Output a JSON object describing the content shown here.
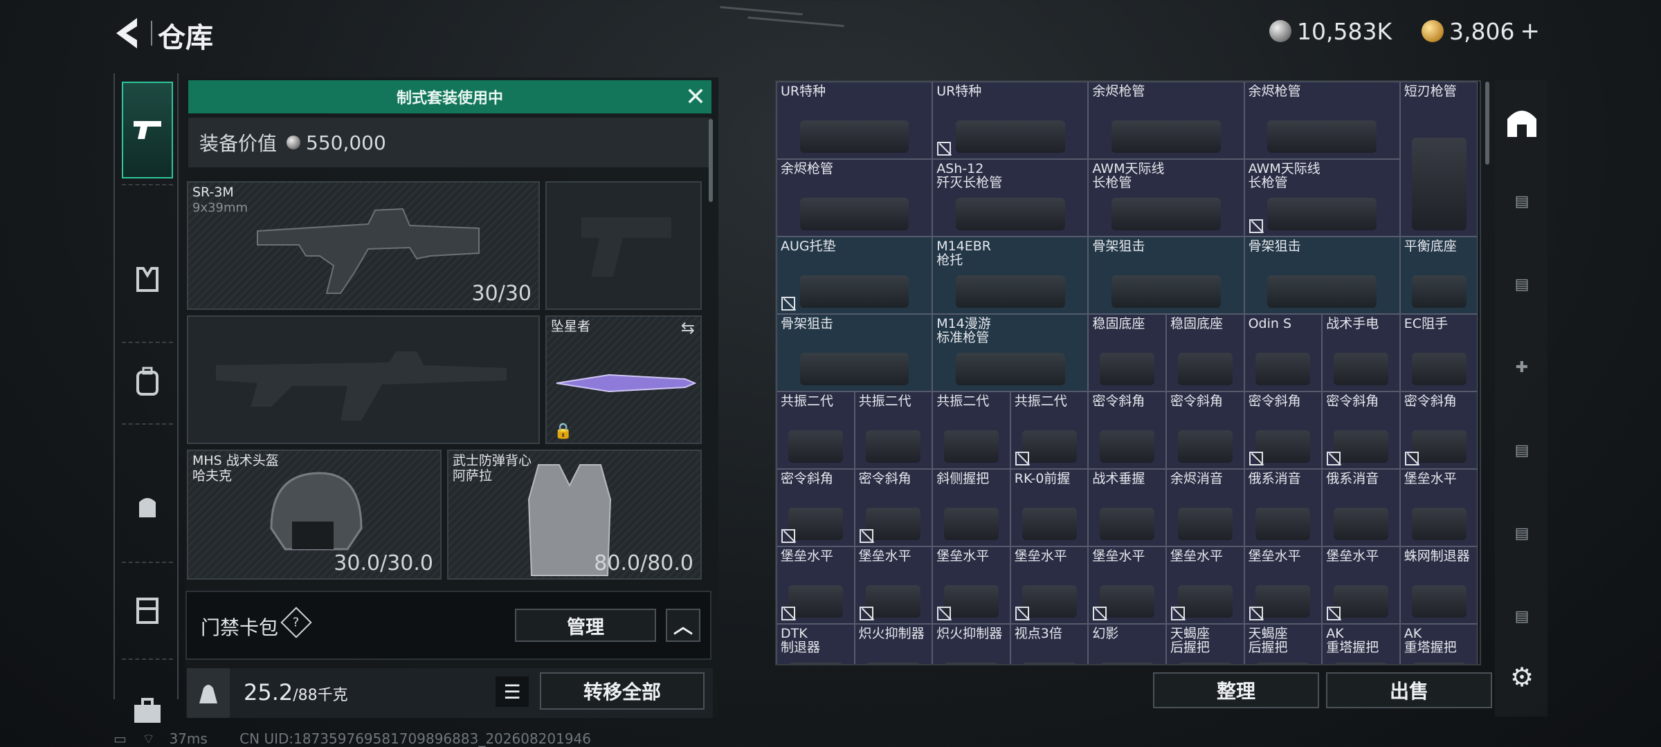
{
  "header": {
    "title": "仓库",
    "silver": "10,583K",
    "gold": "3,806"
  },
  "loadout": {
    "banner": "制式套装使用中",
    "value_label": "装备价值",
    "value": "550,000",
    "primary": {
      "name": "SR-3M",
      "caliber": "9x39mm",
      "ammo": "30/30"
    },
    "melee": {
      "name": "坠星者"
    },
    "helmet": {
      "name": "MHS 战术头盔",
      "sub": "哈夫克",
      "durability": "30.0/30.0"
    },
    "armor": {
      "name": "武士防弹背心",
      "sub": "阿萨拉",
      "durability": "80.0/80.0"
    },
    "keycard": {
      "label": "门禁卡包",
      "help": "?",
      "manage": "管理"
    },
    "weight": {
      "current": "25.2",
      "max": "/88千克"
    },
    "transfer_all": "转移全部"
  },
  "grid": {
    "rows": [
      [
        {
          "l": "UR特种",
          "c": "purple",
          "w": 2
        },
        {
          "l": "UR特种",
          "c": "purple",
          "w": 2,
          "x": 1
        },
        {
          "l": "余烬枪管",
          "c": "purple",
          "w": 2
        },
        {
          "l": "余烬枪管",
          "c": "purple",
          "w": 2
        },
        {
          "l": "短刃枪管",
          "c": "purple",
          "w": 1,
          "h": 2
        }
      ],
      [
        {
          "l": "余烬枪管",
          "c": "purple",
          "w": 2
        },
        {
          "l": "ASh-12",
          "s": "歼灭长枪管",
          "c": "purple",
          "w": 2
        },
        {
          "l": "AWM天际线",
          "s": "长枪管",
          "c": "purple",
          "w": 2
        },
        {
          "l": "AWM天际线",
          "s": "长枪管",
          "c": "purple",
          "w": 2,
          "x": 1
        }
      ],
      [
        {
          "l": "AUG托垫",
          "c": "blue",
          "w": 2,
          "x": 1
        },
        {
          "l": "M14EBR",
          "s": "枪托",
          "c": "blue",
          "w": 2
        },
        {
          "l": "骨架狙击",
          "c": "blue",
          "w": 2
        },
        {
          "l": "骨架狙击",
          "c": "blue",
          "w": 2
        },
        {
          "l": "平衡底座",
          "c": "blue",
          "w": 1
        }
      ],
      [
        {
          "l": "骨架狙击",
          "c": "blue",
          "w": 2
        },
        {
          "l": "M14漫游",
          "s": "标准枪管",
          "c": "blue",
          "w": 2
        },
        {
          "l": "稳固底座",
          "c": "purple",
          "w": 1
        },
        {
          "l": "稳固底座",
          "c": "purple",
          "w": 1
        },
        {
          "l": "Odin S",
          "c": "purple",
          "w": 1
        },
        {
          "l": "战术手电",
          "c": "purple",
          "w": 1
        },
        {
          "l": "EC阻手",
          "c": "purple",
          "w": 1
        }
      ],
      [
        {
          "l": "共振二代",
          "c": "purple",
          "w": 1
        },
        {
          "l": "共振二代",
          "c": "purple",
          "w": 1
        },
        {
          "l": "共振二代",
          "c": "purple",
          "w": 1
        },
        {
          "l": "共振二代",
          "c": "purple",
          "w": 1,
          "x": 1
        },
        {
          "l": "密令斜角",
          "c": "purple",
          "w": 1
        },
        {
          "l": "密令斜角",
          "c": "purple",
          "w": 1
        },
        {
          "l": "密令斜角",
          "c": "purple",
          "w": 1,
          "x": 1
        },
        {
          "l": "密令斜角",
          "c": "purple",
          "w": 1,
          "x": 1
        },
        {
          "l": "密令斜角",
          "c": "purple",
          "w": 1,
          "x": 1
        }
      ],
      [
        {
          "l": "密令斜角",
          "c": "purple",
          "w": 1,
          "x": 1
        },
        {
          "l": "密令斜角",
          "c": "purple",
          "w": 1,
          "x": 1
        },
        {
          "l": "斜侧握把",
          "c": "purple",
          "w": 1
        },
        {
          "l": "RK-0前握",
          "c": "purple",
          "w": 1
        },
        {
          "l": "战术垂握",
          "c": "purple",
          "w": 1
        },
        {
          "l": "余烬消音",
          "c": "purple",
          "w": 1
        },
        {
          "l": "俄系消音",
          "c": "purple",
          "w": 1
        },
        {
          "l": "俄系消音",
          "c": "purple",
          "w": 1
        },
        {
          "l": "堡垒水平",
          "c": "purple",
          "w": 1
        }
      ],
      [
        {
          "l": "堡垒水平",
          "c": "purple",
          "w": 1,
          "x": 1
        },
        {
          "l": "堡垒水平",
          "c": "purple",
          "w": 1,
          "x": 1
        },
        {
          "l": "堡垒水平",
          "c": "purple",
          "w": 1,
          "x": 1
        },
        {
          "l": "堡垒水平",
          "c": "purple",
          "w": 1,
          "x": 1
        },
        {
          "l": "堡垒水平",
          "c": "purple",
          "w": 1,
          "x": 1
        },
        {
          "l": "堡垒水平",
          "c": "purple",
          "w": 1,
          "x": 1
        },
        {
          "l": "堡垒水平",
          "c": "purple",
          "w": 1,
          "x": 1
        },
        {
          "l": "堡垒水平",
          "c": "purple",
          "w": 1,
          "x": 1
        },
        {
          "l": "蛛网制退器",
          "c": "purple",
          "w": 1
        }
      ],
      [
        {
          "l": "DTK",
          "s": "制退器",
          "c": "purple",
          "w": 1
        },
        {
          "l": "炽火抑制器",
          "c": "purple",
          "w": 1
        },
        {
          "l": "炽火抑制器",
          "c": "purple",
          "w": 1
        },
        {
          "l": "视点3倍",
          "c": "purple",
          "w": 1
        },
        {
          "l": "幻影",
          "c": "purple",
          "w": 1
        },
        {
          "l": "天蝎座",
          "s": "后握把",
          "c": "purple",
          "w": 1
        },
        {
          "l": "天蝎座",
          "s": "后握把",
          "c": "purple",
          "w": 1
        },
        {
          "l": "AK",
          "s": "重塔握把",
          "c": "purple",
          "w": 1
        },
        {
          "l": "AK",
          "s": "重塔握把",
          "c": "purple",
          "w": 1
        }
      ]
    ]
  },
  "actions": {
    "sort": "整理",
    "sell": "出售"
  },
  "status": {
    "ping": "37ms",
    "uid": "CN UID:18735976958170989688​3_202608201946"
  }
}
